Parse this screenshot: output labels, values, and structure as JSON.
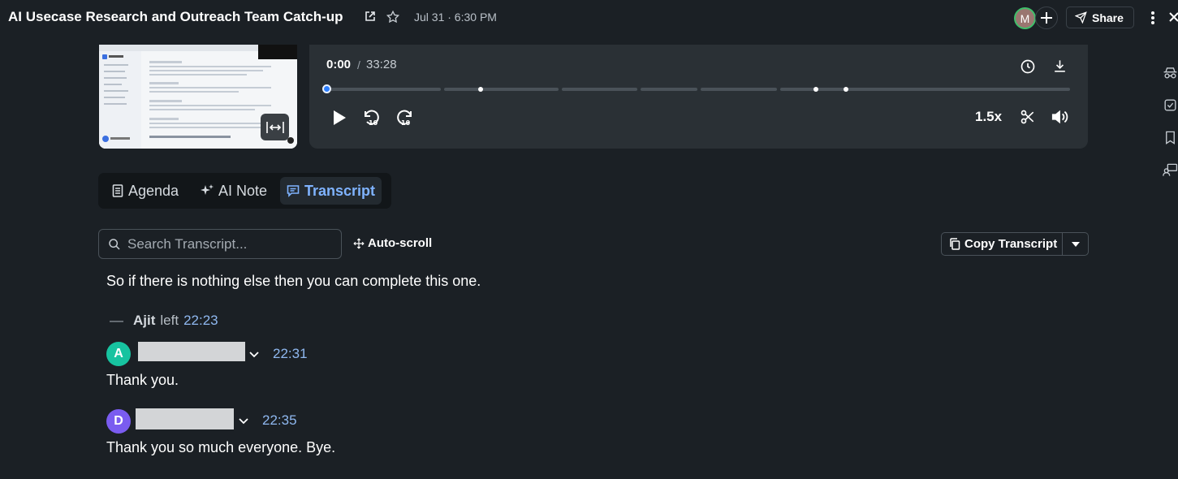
{
  "header": {
    "title": "AI Usecase Research and Outreach Team Catch-up",
    "date": "Jul 31 · 6:30 PM",
    "avatar_initial": "M",
    "share_label": "Share"
  },
  "player": {
    "current_time": "0:00",
    "separator": "/",
    "total_time": "33:28",
    "speed": "1.5x",
    "progress_fraction": 0.0
  },
  "tabs": [
    {
      "label": "Agenda",
      "icon": "document-icon",
      "active": false
    },
    {
      "label": "AI Note",
      "icon": "sparkle-icon",
      "active": false
    },
    {
      "label": "Transcript",
      "icon": "chat-icon",
      "active": true
    }
  ],
  "toolbar": {
    "search_placeholder": "Search Transcript...",
    "autoscroll_label": "Auto-scroll",
    "copy_label": "Copy Transcript"
  },
  "transcript": {
    "prev_text": "So if there is nothing else then you can complete this one.",
    "event": {
      "dash": "—",
      "name": "Ajit",
      "action": "left",
      "time": "22:23"
    },
    "entries": [
      {
        "initial": "A",
        "avatar_color": "#17c3a0",
        "time": "22:31",
        "text": "Thank you."
      },
      {
        "initial": "D",
        "avatar_color": "#7a5cf0",
        "time": "22:35",
        "text": "Thank you so much everyone. Bye."
      }
    ]
  },
  "colors": {
    "background": "#1b2025",
    "panel": "#2a3035",
    "accent": "#2d7fff",
    "link": "#8fb8f0"
  }
}
